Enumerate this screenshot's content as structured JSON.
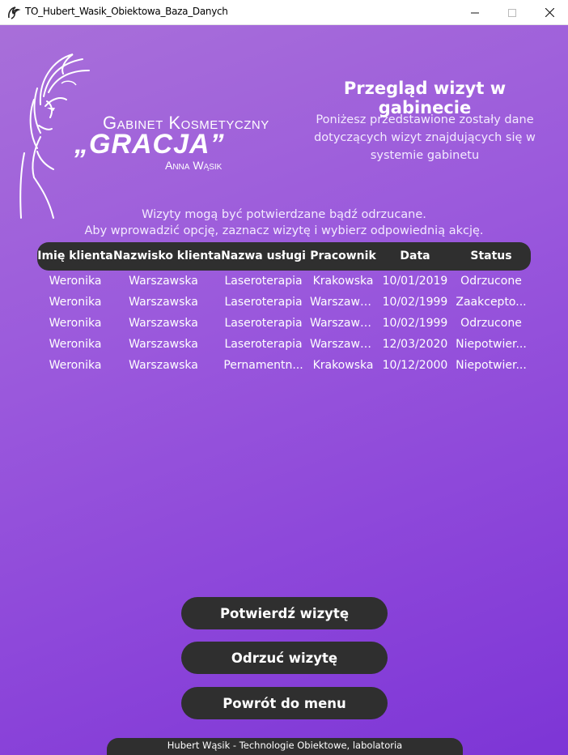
{
  "window": {
    "title": "TO_Hubert_Wasik_Obiektowa_Baza_Danych",
    "controls": {
      "minimize": "—",
      "maximize": "☐",
      "close": "✕"
    }
  },
  "logo": {
    "line1": "Gabinet Kosmetyczny",
    "line2": "„GRACJA”",
    "line3": "Anna Wąsik"
  },
  "header": {
    "title": "Przegląd wizyt w gabinecie",
    "description": "Poniżesz przedstawione zostały dane dotyczących wizyt znajdujących się w systemie gabinetu"
  },
  "info": {
    "line1": "Wizyty mogą być potwierdzane bądź odrzucane.",
    "line2": "Aby wprowadzić opcję, zaznacz wizytę i wybierz odpowiednią akcję."
  },
  "table": {
    "columns": [
      "Imię klienta",
      "Nazwisko klienta",
      "Nazwa usługi",
      "Pracownik",
      "Data",
      "Status"
    ],
    "rows": [
      [
        "Weronika",
        "Warszawska",
        "Laseroterapia",
        "Krakowska",
        "10/01/2019",
        "Odrzucone"
      ],
      [
        "Weronika",
        "Warszawska",
        "Laseroterapia",
        "Warszawska",
        "10/02/1999",
        "Zaakcepto..."
      ],
      [
        "Weronika",
        "Warszawska",
        "Laseroterapia",
        "Warszawska",
        "10/02/1999",
        "Odrzucone"
      ],
      [
        "Weronika",
        "Warszawska",
        "Laseroterapia",
        "Warszawska",
        "12/03/2020",
        "Niepotwier..."
      ],
      [
        "Weronika",
        "Warszawska",
        "Pernamentn...",
        "Krakowska",
        "10/12/2000",
        "Niepotwier..."
      ]
    ]
  },
  "buttons": {
    "confirm": "Potwierdź wizytę",
    "reject": "Odrzuć wizytę",
    "back": "Powrót do menu"
  },
  "footer": {
    "text": "Hubert Wąsik - Technologie Obiektowe, labolatoria"
  },
  "colors": {
    "accent_dark": "#2f2f2f",
    "gradient_start": "#a86fd9",
    "gradient_end": "#7d35d6"
  }
}
